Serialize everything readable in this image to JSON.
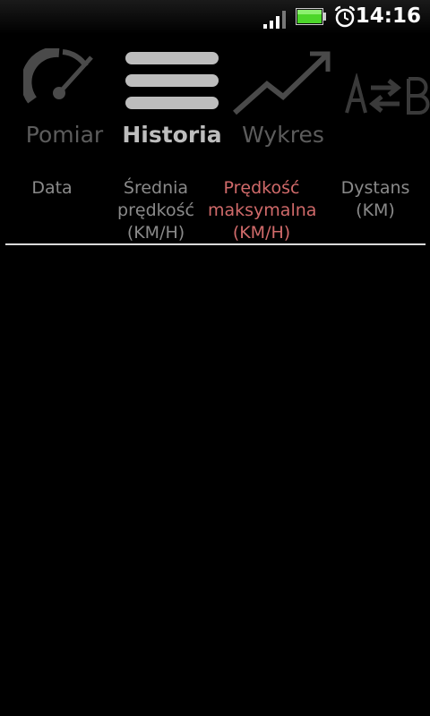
{
  "status_bar": {
    "time": "14:16",
    "icons": [
      "signal-icon",
      "battery-icon",
      "alarm-icon"
    ]
  },
  "tabs": [
    {
      "label": "Pomiar",
      "icon": "speedometer-icon",
      "selected": false
    },
    {
      "label": "Historia",
      "icon": "list-icon",
      "selected": true
    },
    {
      "label": "Wykres",
      "icon": "chart-trend-icon",
      "selected": false
    },
    {
      "label": "",
      "icon": "convert-units-icon",
      "selected": false
    }
  ],
  "table": {
    "columns": [
      {
        "label": "Data",
        "sorted": false
      },
      {
        "label": "Średnia prędkość (KM/H)",
        "sorted": false
      },
      {
        "label": "Prędkość maksymalna (KM/H)",
        "sorted": true
      },
      {
        "label": "Dystans (KM)",
        "sorted": false
      }
    ],
    "rows": []
  },
  "colors": {
    "background": "#000000",
    "active_tab": "#bdbdbd",
    "inactive_tab": "#5c5c5c",
    "sorted_column": "#d06a6a",
    "column_header": "#8a8a8a"
  }
}
